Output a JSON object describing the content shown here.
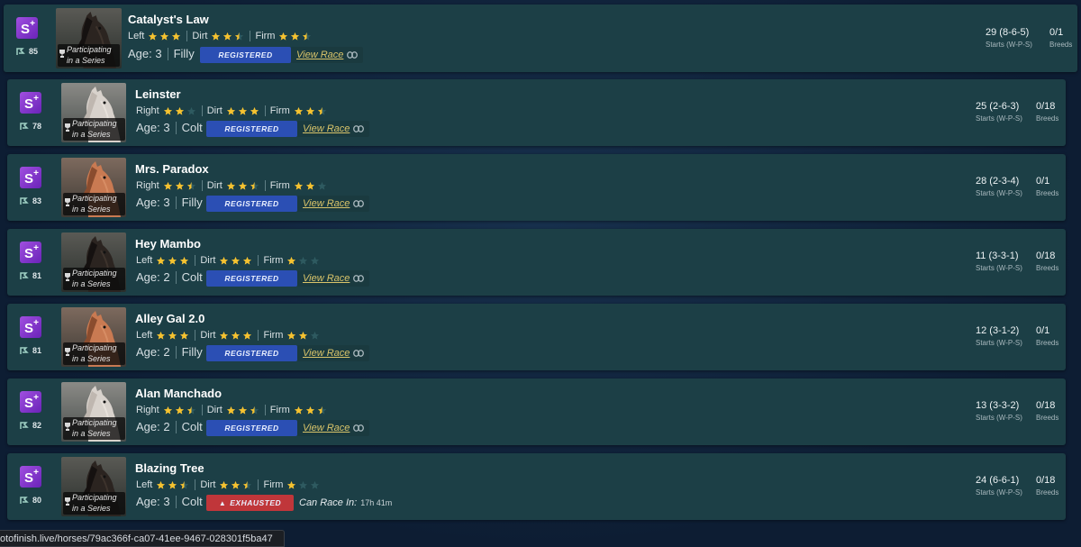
{
  "url_status": "otofinish.live/horses/79ac366f-ca07-41ee-9467-028301f5ba47",
  "colors": {
    "card_bg": "#1c3f46",
    "registered": "#2b4fb4",
    "exhausted": "#c0363a",
    "star": "#f5c230",
    "link": "#d9c46a",
    "splus": "#8a3bd4"
  },
  "icons": {
    "splus": "S+",
    "rating": "rating-flag-icon",
    "trophy": "trophy-icon",
    "link": "link-icon",
    "warning": "▲"
  },
  "labels": {
    "series": "Participating in a Series",
    "age_prefix": "Age:",
    "view_race": "View Race",
    "starts_sub": "Starts (W-P-S)",
    "breeds_sub": "Breeds",
    "can_race": "Can Race In:"
  },
  "horses": [
    {
      "name": "Catalyst's Law",
      "rating": "85",
      "surfaces": [
        {
          "label": "Left",
          "stars": 3
        },
        {
          "label": "Dirt",
          "stars": 2.5
        },
        {
          "label": "Firm",
          "stars": 2.5
        }
      ],
      "age": "3",
      "sex": "Filly",
      "status": "REGISTERED",
      "starts": "29 (8-6-5)",
      "breeds": "0/1",
      "coat": "dark"
    },
    {
      "name": "Leinster",
      "rating": "78",
      "surfaces": [
        {
          "label": "Right",
          "stars": 2
        },
        {
          "label": "Dirt",
          "stars": 3
        },
        {
          "label": "Firm",
          "stars": 2.5
        }
      ],
      "age": "3",
      "sex": "Colt",
      "status": "REGISTERED",
      "starts": "25 (2-6-3)",
      "breeds": "0/18",
      "coat": "grey"
    },
    {
      "name": "Mrs. Paradox",
      "rating": "83",
      "surfaces": [
        {
          "label": "Right",
          "stars": 2.5
        },
        {
          "label": "Dirt",
          "stars": 2.5
        },
        {
          "label": "Firm",
          "stars": 2
        }
      ],
      "age": "3",
      "sex": "Filly",
      "status": "REGISTERED",
      "starts": "28 (2-3-4)",
      "breeds": "0/1",
      "coat": "chestnut"
    },
    {
      "name": "Hey Mambo",
      "rating": "81",
      "surfaces": [
        {
          "label": "Left",
          "stars": 3
        },
        {
          "label": "Dirt",
          "stars": 3
        },
        {
          "label": "Firm",
          "stars": 1
        }
      ],
      "age": "2",
      "sex": "Colt",
      "status": "REGISTERED",
      "starts": "11 (3-3-1)",
      "breeds": "0/18",
      "coat": "dark"
    },
    {
      "name": "Alley Gal 2.0",
      "rating": "81",
      "surfaces": [
        {
          "label": "Left",
          "stars": 3
        },
        {
          "label": "Dirt",
          "stars": 3
        },
        {
          "label": "Firm",
          "stars": 2
        }
      ],
      "age": "2",
      "sex": "Filly",
      "status": "REGISTERED",
      "starts": "12 (3-1-2)",
      "breeds": "0/1",
      "coat": "chestnut"
    },
    {
      "name": "Alan Manchado",
      "rating": "82",
      "surfaces": [
        {
          "label": "Right",
          "stars": 2.5
        },
        {
          "label": "Dirt",
          "stars": 2.5
        },
        {
          "label": "Firm",
          "stars": 2.5
        }
      ],
      "age": "2",
      "sex": "Colt",
      "status": "REGISTERED",
      "starts": "13 (3-3-2)",
      "breeds": "0/18",
      "coat": "grey"
    },
    {
      "name": "Blazing Tree",
      "rating": "80",
      "surfaces": [
        {
          "label": "Left",
          "stars": 2.5
        },
        {
          "label": "Dirt",
          "stars": 2.5
        },
        {
          "label": "Firm",
          "stars": 1
        }
      ],
      "age": "3",
      "sex": "Colt",
      "status": "EXHAUSTED",
      "can_race_time": "17h 41m",
      "starts": "24 (6-6-1)",
      "breeds": "0/18",
      "coat": "dark"
    }
  ]
}
